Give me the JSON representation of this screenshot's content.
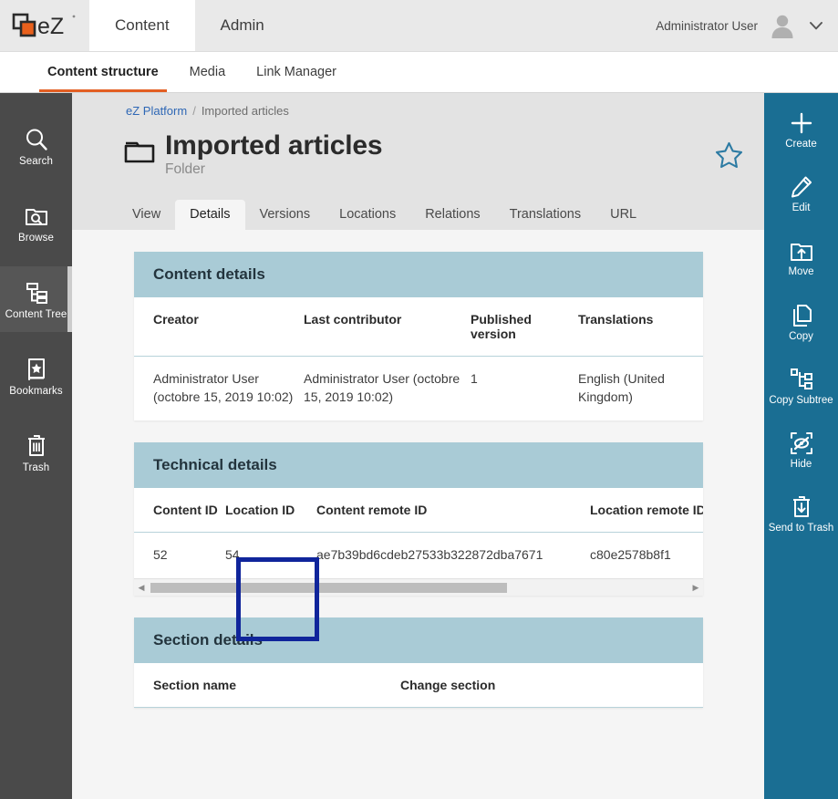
{
  "brand": {
    "logo_alt": "eZ",
    "accent_orange": "#e35f23",
    "accent_blue": "#1a6e93",
    "panel_header": "#a9cbd6",
    "highlight": "#10259b"
  },
  "topbar": {
    "tabs": [
      {
        "label": "Content",
        "active": true
      },
      {
        "label": "Admin",
        "active": false
      }
    ],
    "user_name": "Administrator User",
    "avatar_icon": "user-avatar-icon",
    "caret_icon": "chevron-down-icon"
  },
  "subnav": {
    "items": [
      {
        "label": "Content structure",
        "active": true
      },
      {
        "label": "Media",
        "active": false
      },
      {
        "label": "Link Manager",
        "active": false
      }
    ]
  },
  "left_rail": {
    "items": [
      {
        "label": "Search",
        "icon": "search-icon",
        "active": false
      },
      {
        "label": "Browse",
        "icon": "browse-folder-icon",
        "active": false
      },
      {
        "label": "Content Tree",
        "icon": "content-tree-icon",
        "active": true
      },
      {
        "label": "Bookmarks",
        "icon": "bookmarks-book-icon",
        "active": false
      },
      {
        "label": "Trash",
        "icon": "trash-icon",
        "active": false
      }
    ]
  },
  "right_rail": {
    "items": [
      {
        "label": "Create",
        "icon": "plus-icon"
      },
      {
        "label": "Edit",
        "icon": "pencil-icon"
      },
      {
        "label": "Move",
        "icon": "move-folder-icon"
      },
      {
        "label": "Copy",
        "icon": "copy-pages-icon"
      },
      {
        "label": "Copy Subtree",
        "icon": "copy-subtree-icon"
      },
      {
        "label": "Hide",
        "icon": "hide-eye-icon"
      },
      {
        "label": "Send to Trash",
        "icon": "send-to-trash-icon"
      }
    ]
  },
  "breadcrumb": {
    "root": "eZ Platform",
    "separator": "/",
    "current": "Imported articles"
  },
  "page": {
    "title": "Imported articles",
    "subtitle": "Folder",
    "type_icon": "folder-icon",
    "bookmark_icon": "star-outline-icon"
  },
  "tabs": [
    {
      "label": "View",
      "active": false
    },
    {
      "label": "Details",
      "active": true
    },
    {
      "label": "Versions",
      "active": false
    },
    {
      "label": "Locations",
      "active": false
    },
    {
      "label": "Relations",
      "active": false
    },
    {
      "label": "Translations",
      "active": false
    },
    {
      "label": "URL",
      "active": false
    }
  ],
  "content_details": {
    "title": "Content details",
    "columns": [
      "Creator",
      "Last contributor",
      "Published version",
      "Translations"
    ],
    "row": {
      "creator": "Administrator User (octobre 15, 2019 10:02)",
      "last_contributor": "Administrator User (octobre 15, 2019 10:02)",
      "published_version": "1",
      "translations": "English (United Kingdom)"
    }
  },
  "technical_details": {
    "title": "Technical details",
    "columns": [
      "Content ID",
      "Location ID",
      "Content remote ID",
      "Location remote ID"
    ],
    "row": {
      "content_id": "52",
      "location_id": "54",
      "content_remote_id": "ae7b39bd6cdeb27533b322872dba7671",
      "location_remote_id": "c80e2578b8f1"
    },
    "scrollbar": {
      "left_arrow": "◀",
      "right_arrow": "▶"
    }
  },
  "section_details": {
    "title": "Section details",
    "columns": [
      "Section name",
      "Change section"
    ]
  }
}
